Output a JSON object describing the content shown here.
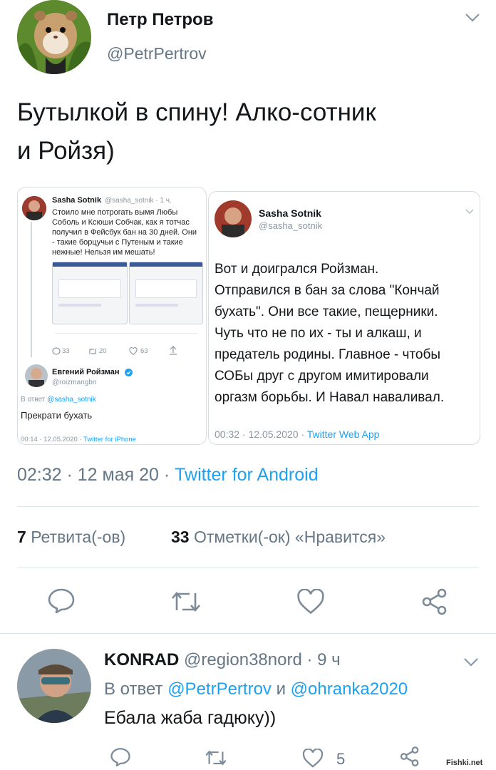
{
  "tweet": {
    "author_name": "Петр Петров",
    "author_handle": "@PetrPertrov",
    "text_line1": "Бутылкой в спину! Алко-сотник",
    "text_line2": "и Ройзя)",
    "timestamp": "02:32 · 12 мая 20 ·",
    "source": "Twitter for Android",
    "retweets_count": "7",
    "retweets_label": "Ретвита(-ов)",
    "likes_count": "33",
    "likes_label": "Отметки(-ок) «Нравится»"
  },
  "embedded_left": {
    "name": "Sasha Sotnik",
    "handle_time": "@sasha_sotnik · 1 ч.",
    "lines": [
      "Стоило мне потрогать вымя Любы",
      "Соболь и Ксюши Собчак, как я тотчас",
      "получил в Фейсбук бан на 30 дней. Они",
      "- такие борцучьи с Путеным и такие",
      "нежные! Нельзя им мешать!"
    ],
    "reply_count": "33",
    "rt_count": "20",
    "like_count": "63",
    "reply_name": "Евгений Ройзман",
    "reply_handle": "@roizmangbn",
    "reply_to_prefix": "В ответ",
    "reply_to_handle": "@sasha_sotnik",
    "reply_text": "Прекрати бухать",
    "reply_meta": "00:14 · 12.05.2020 ·",
    "reply_source": "Twitter for iPhone"
  },
  "embedded_right": {
    "name": "Sasha Sotnik",
    "handle": "@sasha_sotnik",
    "lines": [
      "Вот и доигрался Ройзман.",
      "Отправился в бан за слова \"Кончай",
      "бухать\". Они все такие, пещерники.",
      "Чуть что не по их - ты и алкаш, и",
      "предатель родины. Главное - чтобы",
      "СОБы друг с другом имитировали",
      "оргазм борьбы. И Навал наваливал."
    ],
    "meta": "00:32 · 12.05.2020 ·",
    "source": "Twitter Web App"
  },
  "reply": {
    "name": "KONRAD",
    "handle_time": "@region38nord · 9 ч",
    "reply_to_prefix": "В ответ",
    "reply_to_user1": "@PetrPertrov",
    "reply_to_and": "и",
    "reply_to_user2": "@ohranka2020",
    "text": "Ебала жаба гадюку))",
    "like_count": "5"
  },
  "watermark": "Fishki.net",
  "colors": {
    "accent": "#1da1f2",
    "secondary_text": "#657786",
    "divider": "#e1e8ed"
  }
}
